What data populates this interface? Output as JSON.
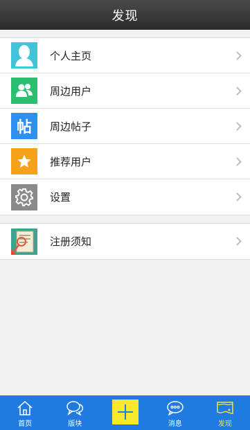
{
  "header": {
    "title": "发现"
  },
  "menu": {
    "group1": [
      {
        "label": "个人主页",
        "icon": "profile-icon"
      },
      {
        "label": "周边用户",
        "icon": "nearby-users-icon"
      },
      {
        "label": "周边帖子",
        "icon": "nearby-posts-icon",
        "glyph": "帖"
      },
      {
        "label": "推荐用户",
        "icon": "star-icon"
      },
      {
        "label": "设置",
        "icon": "gear-icon"
      }
    ],
    "group2": [
      {
        "label": "注册须知",
        "icon": "registration-notice-icon"
      }
    ]
  },
  "tabbar": {
    "items": [
      {
        "label": "首页",
        "icon": "home-icon"
      },
      {
        "label": "版块",
        "icon": "forum-icon"
      },
      {
        "label": "",
        "icon": "plus-icon"
      },
      {
        "label": "消息",
        "icon": "message-icon"
      },
      {
        "label": "发现",
        "icon": "discover-icon",
        "active": true
      }
    ]
  },
  "colors": {
    "header_bg": "#2b2b2b",
    "tabbar_bg": "#1f7be0",
    "active_tab": "#f7e13b",
    "plus_button": "#f7ea2a"
  }
}
